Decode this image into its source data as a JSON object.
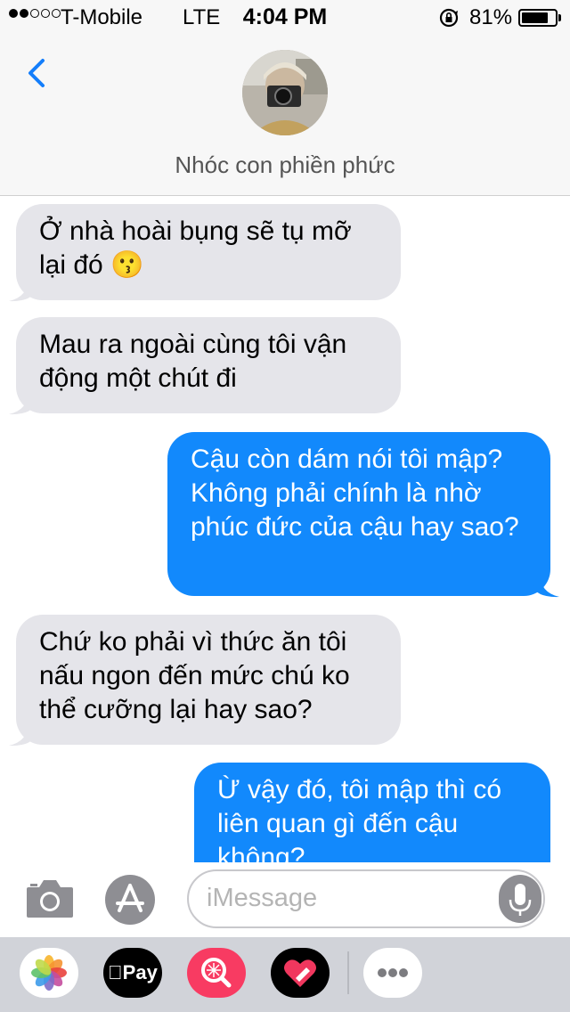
{
  "status_bar": {
    "carrier": "T-Mobile",
    "network": "LTE",
    "time": "4:04 PM",
    "battery_percent": "81%",
    "battery_level": 0.81,
    "signal_bars": 2
  },
  "header": {
    "contact_name": "Nhóc con phiền phức",
    "back_icon": "chevron-left-icon"
  },
  "messages": [
    {
      "from": "contact",
      "text": "Ở nhà hoài bụng sẽ tụ mỡ lại đó 😗"
    },
    {
      "from": "contact",
      "text": "Mau ra ngoài cùng tôi vận động một chút đi"
    },
    {
      "from": "me",
      "text": "Cậu còn dám nói tôi mập? Không phải chính là nhờ phúc đức của cậu hay sao?"
    },
    {
      "from": "contact",
      "text": "Chứ ko phải vì thức ăn tôi nấu ngon đến mức chú ko thể cưỡng lại hay sao?"
    },
    {
      "from": "me",
      "text": "Ừ vậy đó, tôi mập thì có liên quan gì đến cậu không?"
    }
  ],
  "compose": {
    "placeholder": "iMessage",
    "camera_icon": "camera-icon",
    "appstore_icon": "app-store-icon",
    "mic_icon": "microphone-icon"
  },
  "app_drawer": {
    "items": [
      {
        "name": "photos-icon"
      },
      {
        "name": "apple-pay-icon",
        "label": "Pay"
      },
      {
        "name": "image-search-icon"
      },
      {
        "name": "heart-digital-touch-icon"
      },
      {
        "name": "more-apps-icon"
      }
    ]
  },
  "colors": {
    "sent_bubble": "#1289fc",
    "received_bubble": "#e5e5ea",
    "accent": "#147efb"
  }
}
